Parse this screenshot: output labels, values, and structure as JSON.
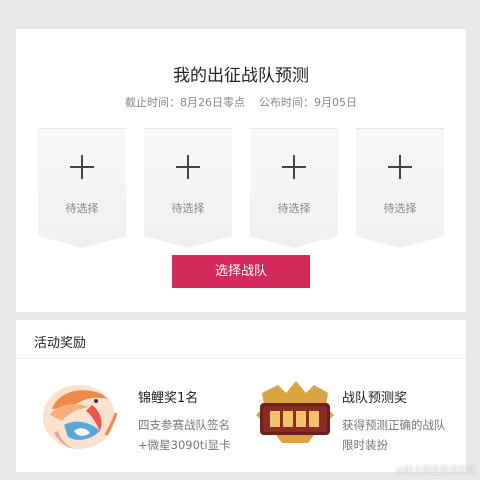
{
  "predict": {
    "title": "我的出征战队预测",
    "deadline": "截止时间：8月26日零点",
    "publish": "公布时间：9月05日",
    "slots": [
      {
        "label": "待选择"
      },
      {
        "label": "待选择"
      },
      {
        "label": "待选择"
      },
      {
        "label": "待选择"
      }
    ],
    "select_button": "选择战队"
  },
  "rewards": {
    "header": "活动奖励",
    "items": [
      {
        "name": "锦鲤奖1名",
        "desc_line1": "四支参赛战队签名",
        "desc_line2": "+微星3090ti显卡"
      },
      {
        "name": "战队预测奖",
        "desc_line1": "获得预测正确的战队",
        "desc_line2": "限时装扮"
      }
    ]
  },
  "watermark": "@稀土掘金技术社区",
  "colors": {
    "accent": "#d62a5c",
    "page_bg": "#e9e9eb"
  }
}
